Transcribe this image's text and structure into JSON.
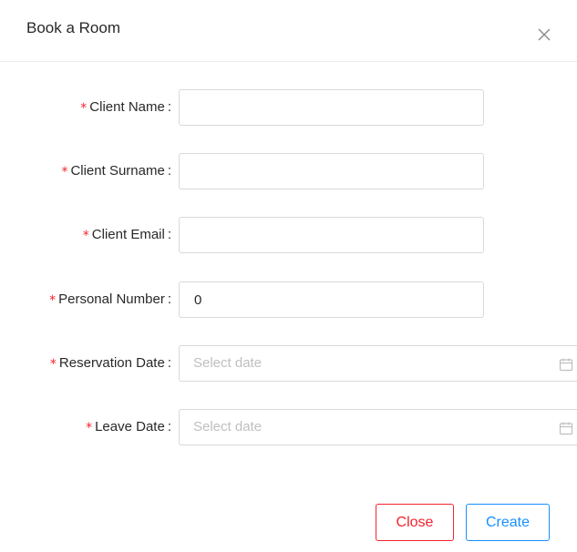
{
  "modal": {
    "title": "Book a Room"
  },
  "form": {
    "required_mark": "*",
    "colon": ":",
    "fields": [
      {
        "label": "Client Name",
        "value": ""
      },
      {
        "label": "Client Surname",
        "value": ""
      },
      {
        "label": "Client Email",
        "value": ""
      },
      {
        "label": "Personal Number",
        "value": "0"
      },
      {
        "label": "Reservation Date",
        "placeholder": "Select date"
      },
      {
        "label": "Leave Date",
        "placeholder": "Select date"
      }
    ]
  },
  "footer": {
    "close_label": "Close",
    "create_label": "Create"
  },
  "colors": {
    "required": "#f5222d",
    "danger": "#f5222d",
    "primary": "#1890ff",
    "border": "#d9d9d9"
  },
  "icons": {
    "close": "close-icon",
    "calendar": "calendar-icon"
  }
}
